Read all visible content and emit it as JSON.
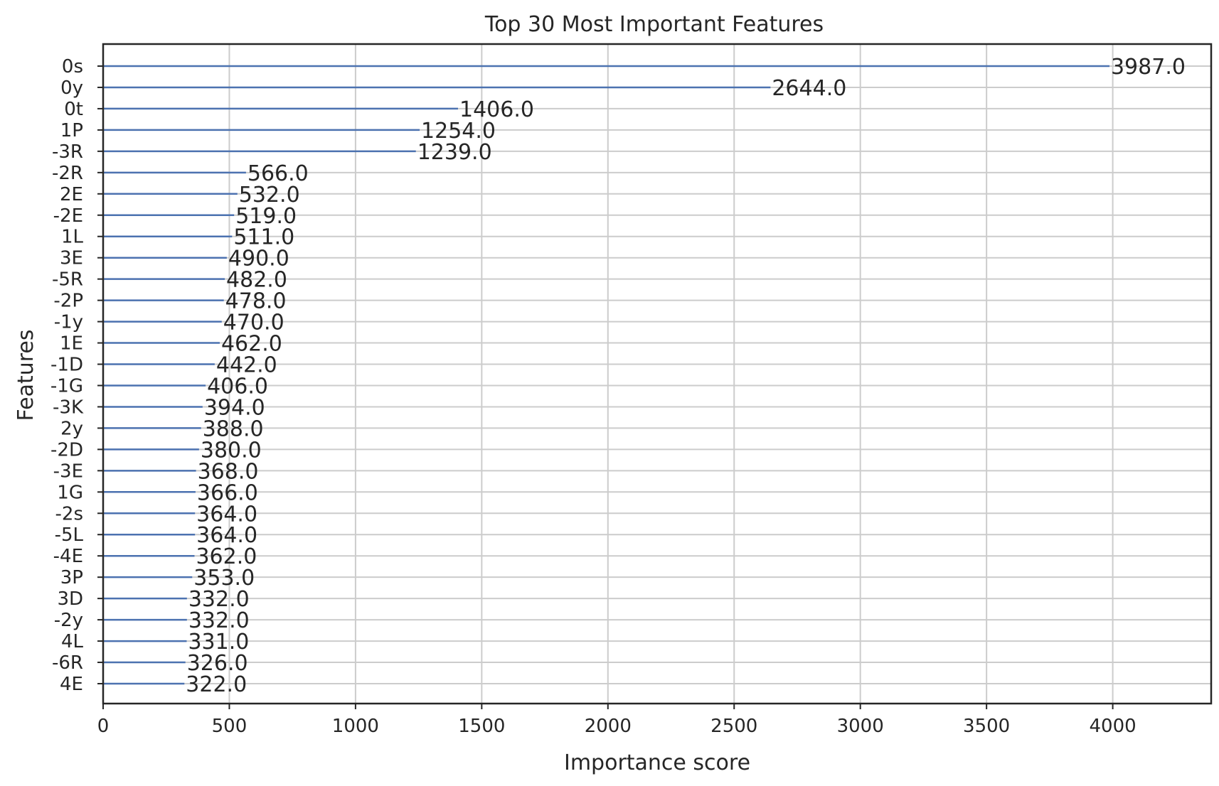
{
  "chart_data": {
    "type": "bar",
    "orientation": "horizontal",
    "title": "Top 30 Most Important Features",
    "xlabel": "Importance score",
    "ylabel": "Features",
    "xlim": [
      0,
      4390
    ],
    "xticks": [
      0,
      500,
      1000,
      1500,
      2000,
      2500,
      3000,
      3500,
      4000
    ],
    "grid": true,
    "bar_color": "#4c72b0",
    "categories": [
      "0s",
      "0y",
      "0t",
      "1P",
      "-3R",
      "-2R",
      "2E",
      "-2E",
      "1L",
      "3E",
      "-5R",
      "-2P",
      "-1y",
      "1E",
      "-1D",
      "-1G",
      "-3K",
      "2y",
      "-2D",
      "-3E",
      "1G",
      "-2s",
      "-5L",
      "-4E",
      "3P",
      "3D",
      "-2y",
      "4L",
      "-6R",
      "4E"
    ],
    "values": [
      3987.0,
      2644.0,
      1406.0,
      1254.0,
      1239.0,
      566.0,
      532.0,
      519.0,
      511.0,
      490.0,
      482.0,
      478.0,
      470.0,
      462.0,
      442.0,
      406.0,
      394.0,
      388.0,
      380.0,
      368.0,
      366.0,
      364.0,
      364.0,
      362.0,
      353.0,
      332.0,
      332.0,
      331.0,
      326.0,
      322.0
    ],
    "value_labels": [
      "3987.0",
      "2644.0",
      "1406.0",
      "1254.0",
      "1239.0",
      "566.0",
      "532.0",
      "519.0",
      "511.0",
      "490.0",
      "482.0",
      "478.0",
      "470.0",
      "462.0",
      "442.0",
      "406.0",
      "394.0",
      "388.0",
      "380.0",
      "368.0",
      "366.0",
      "364.0",
      "364.0",
      "362.0",
      "353.0",
      "332.0",
      "332.0",
      "331.0",
      "326.0",
      "322.0"
    ]
  }
}
